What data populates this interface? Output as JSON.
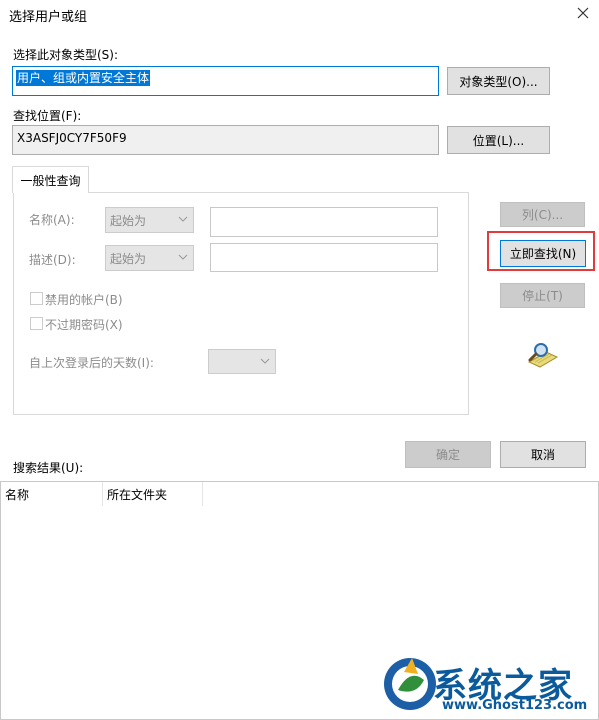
{
  "window": {
    "title": "选择用户或组"
  },
  "object_type": {
    "label": "选择此对象类型(S):",
    "value": "用户、组或内置安全主体",
    "button": "对象类型(O)..."
  },
  "location": {
    "label": "查找位置(F):",
    "value": "X3ASFJ0CY7F50F9",
    "button": "位置(L)..."
  },
  "query": {
    "tab": "一般性查询",
    "name_label": "名称(A):",
    "name_mode": "起始为",
    "desc_label": "描述(D):",
    "desc_mode": "起始为",
    "disabled_accounts": "禁用的帐户(B)",
    "non_expiring_pw": "不过期密码(X)",
    "days_label": "自上次登录后的天数(I):"
  },
  "side_buttons": {
    "columns": "列(C)...",
    "find_now": "立即查找(N)",
    "stop": "停止(T)"
  },
  "dialog_buttons": {
    "ok": "确定",
    "cancel": "取消"
  },
  "results": {
    "label": "搜索结果(U):",
    "columns": [
      "名称",
      "所在文件夹"
    ]
  },
  "watermark": {
    "brand": "系统之家",
    "url": "www.Ghost123.com"
  },
  "colors": {
    "selection": "#0078d7",
    "highlight_box": "#e23b3b"
  }
}
